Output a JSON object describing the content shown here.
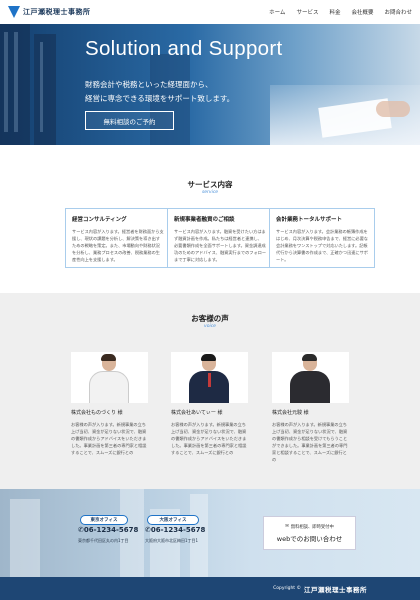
{
  "header": {
    "logo_text": "江戸瀬税理士事務所",
    "nav": [
      "ホーム",
      "サービス",
      "料金",
      "会社概要",
      "お問合わせ"
    ]
  },
  "hero": {
    "title": "Solution and Support",
    "line1": "財務会計や税務といった経理面から、",
    "line2": "経営に専念できる環境をサポート致します。",
    "button_label": "無料相談のご予約"
  },
  "services": {
    "title": "サービス内容",
    "subtitle": "service",
    "cards": [
      {
        "title": "経営コンサルティング",
        "body": "サービス内容が入ります。経営者を財務面から支援し、現状の課題を分析し、解決策を導き出すための戦略を策定。また、市場動向や財務状況を分析し、業務プロセスの改善、税務業務の生産性向上を支援します。"
      },
      {
        "title": "新規事業者融資のご相談",
        "body": "サービス内容が入ります。融資を受けたい方はまず融資計画を作成。私たちは経営者と連携し、必要書類作成を全面サポートします。資金調達成功のためのアドバイス、融資実行までのフォローまで丁寧に対応します。"
      },
      {
        "title": "会計業務トータルサポート",
        "body": "サービス内容が入ります。会計業務の帳簿作成をはじめ、月次決算や税務申告まで、経営に必要な会計業務をワンストップで対応いたします。記帳代行から決算書の作成まで、正確かつ迅速にサポート。"
      }
    ]
  },
  "voices": {
    "title": "お客様の声",
    "subtitle": "voice",
    "items": [
      {
        "name": "株式会社ものづくり 様",
        "text": "お客様の声が入ります。新規事業の立ち上げ当初、資金が足りない状況で、融資の書類作成からアドバイスをいただきました。事業計画を第三者の専門家と相談することで、スムーズに銀行との"
      },
      {
        "name": "株式会社あいてぃー 様",
        "text": "お客様の声が入ります。新規事業の立ち上げ当初、資金が足りない状況で、融資の書類作成からアドバイスをいただきました。事業計画を第三者の専門家と相談することで、スムーズに銀行との"
      },
      {
        "name": "株式会社元駿 様",
        "text": "お客様の声が入ります。新規事業の立ち上げ当初、資金が足りない状況で、融資の書類作成から相談を受けてもらうことができました。事業計画を第三者の専門家と相談することで、スムーズに銀行との"
      }
    ]
  },
  "contact": {
    "offices": [
      {
        "label": "東京オフィス",
        "tel": "06-1234-5678",
        "address": "東京都千代田区丸の内1丁目"
      },
      {
        "label": "大阪オフィス",
        "tel": "06-1234-5678",
        "address": "大阪府大阪市北区梅田1丁目1"
      }
    ],
    "mail_small": "無料相談、即時受付中",
    "mail_big": "webでのお問い合わせ"
  },
  "footer": {
    "copyright": "Copyright ©",
    "company": "江戸瀬税理士事務所"
  },
  "colors": {
    "accent": "#1f73c7",
    "footer_bg": "#1e4674",
    "card_border": "#a9cdec"
  }
}
